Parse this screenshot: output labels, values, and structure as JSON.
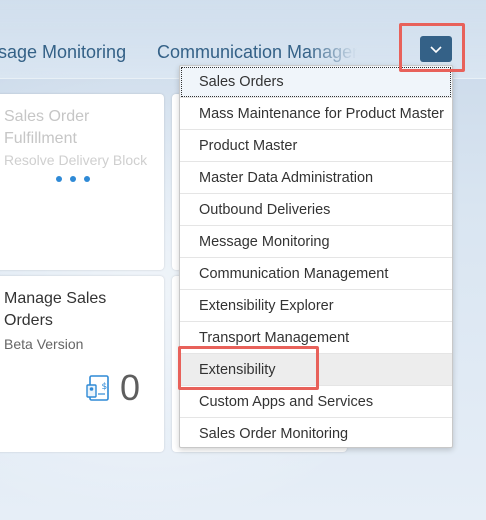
{
  "tabs": [
    {
      "label": "sage Monitoring"
    },
    {
      "label": "Communication Management"
    }
  ],
  "overflow_icon": "chevron-down-icon",
  "tiles": [
    {
      "title": "Sales Order Fulfillment",
      "subtitle": "Resolve Delivery Block",
      "state": "loading"
    },
    {
      "title": "Manage Sales Orders",
      "subtitle": "Beta Version",
      "kpi": "0",
      "icon": "sales-document-icon"
    }
  ],
  "menu": {
    "items": [
      {
        "label": "Sales Orders"
      },
      {
        "label": "Mass Maintenance for Product Master"
      },
      {
        "label": "Product Master"
      },
      {
        "label": "Master Data Administration"
      },
      {
        "label": "Outbound Deliveries"
      },
      {
        "label": "Message Monitoring"
      },
      {
        "label": "Communication Management"
      },
      {
        "label": "Extensibility Explorer"
      },
      {
        "label": "Transport Management"
      },
      {
        "label": "Extensibility"
      },
      {
        "label": "Custom Apps and Services"
      },
      {
        "label": "Sales Order Monitoring"
      }
    ]
  },
  "colors": {
    "accent": "#346187",
    "highlight": "#e8615a",
    "loading_dots": "#2f8ad6"
  }
}
